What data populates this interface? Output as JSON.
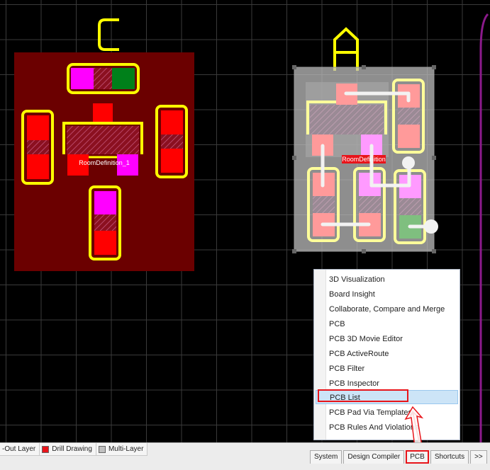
{
  "canvas": {
    "component_c": {
      "designator": "C",
      "room_label": "RoomDefinition_1"
    },
    "component_a": {
      "designator": "A",
      "room_label": "RoomDefinition"
    }
  },
  "context_menu": {
    "items": [
      {
        "label": "3D Visualization"
      },
      {
        "label": "Board Insight"
      },
      {
        "label": "Collaborate, Compare and Merge"
      },
      {
        "label": "PCB"
      },
      {
        "label": "PCB 3D Movie Editor"
      },
      {
        "label": "PCB ActiveRoute"
      },
      {
        "label": "PCB Filter"
      },
      {
        "label": "PCB Inspector"
      },
      {
        "label": "PCB List"
      },
      {
        "label": "PCB Pad Via Templates"
      },
      {
        "label": "PCB Rules And Violations"
      }
    ],
    "highlighted_index": 8
  },
  "layer_tabs": [
    {
      "label": "-Out Layer",
      "color": ""
    },
    {
      "label": "Drill Drawing",
      "color": "#e8141a"
    },
    {
      "label": "Multi-Layer",
      "color": "#c0c0c0"
    }
  ],
  "panel_tabs": [
    {
      "label": "System",
      "active": false
    },
    {
      "label": "Design Compiler",
      "active": false
    },
    {
      "label": "PCB",
      "active": true
    },
    {
      "label": "Shortcuts",
      "active": false
    },
    {
      "label": ">>",
      "active": false
    }
  ],
  "colors": {
    "room_fill": "#6b0000",
    "pad": "#ff0000",
    "silkscreen": "#ffff00",
    "selection_overlay": "#9a9a9a",
    "highlight_red": "#e8141a"
  }
}
